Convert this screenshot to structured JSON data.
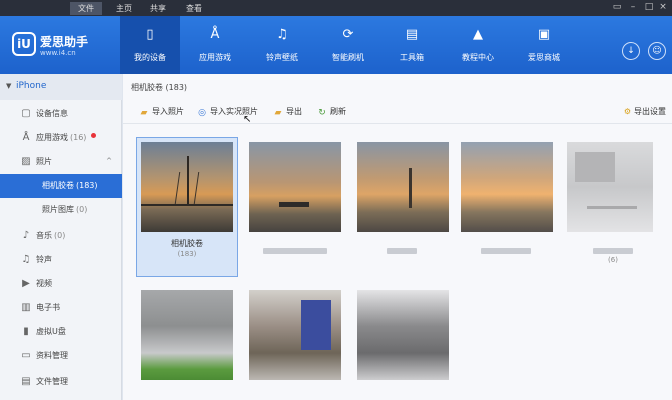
{
  "menubar": {
    "items": [
      "文件",
      "主页",
      "共享",
      "查看"
    ],
    "active_index": 0
  },
  "app": {
    "logo_text": "iU",
    "name": "爱思助手",
    "url": "www.i4.cn"
  },
  "nav": [
    {
      "label": "我的设备",
      "icon": "phone-icon",
      "active": true
    },
    {
      "label": "应用游戏",
      "icon": "app-store-icon",
      "active": false
    },
    {
      "label": "铃声壁纸",
      "icon": "music-file-icon",
      "active": false
    },
    {
      "label": "智能刷机",
      "icon": "refresh-icon",
      "active": false
    },
    {
      "label": "工具箱",
      "icon": "toolbox-icon",
      "active": false
    },
    {
      "label": "教程中心",
      "icon": "graduation-cap-icon",
      "active": false
    },
    {
      "label": "爱思商城",
      "icon": "store-icon",
      "active": false
    }
  ],
  "sidebar": {
    "device": "iPhone",
    "items": [
      {
        "label": "设备信息",
        "count": "",
        "icon": "info-icon"
      },
      {
        "label": "应用游戏",
        "count": "(16)",
        "icon": "apps-icon",
        "badge": true
      },
      {
        "label": "照片",
        "count": "",
        "icon": "photo-icon",
        "expanded": true
      },
      {
        "label": "相机胶卷",
        "count": "(183)",
        "sub": true,
        "selected": true
      },
      {
        "label": "照片图库",
        "count": "(0)",
        "sub": true
      },
      {
        "label": "音乐",
        "count": "(0)",
        "icon": "music-icon"
      },
      {
        "label": "铃声",
        "count": "",
        "icon": "bell-icon"
      },
      {
        "label": "视频",
        "count": "",
        "icon": "video-icon"
      },
      {
        "label": "电子书",
        "count": "",
        "icon": "book-icon"
      },
      {
        "label": "虚拟U盘",
        "count": "",
        "icon": "usb-icon"
      },
      {
        "label": "资料管理",
        "count": "",
        "icon": "folder-icon"
      },
      {
        "label": "文件管理",
        "count": "",
        "icon": "file-icon"
      }
    ]
  },
  "main": {
    "breadcrumb": "相机胶卷 (183)",
    "toolbar": {
      "import_photos": "导入照片",
      "import_live": "导入实况照片",
      "export": "导出",
      "refresh": "刷新",
      "export_settings": "导出设置"
    },
    "albums": [
      {
        "label": "相机胶卷",
        "count": "(183)",
        "selected": true
      },
      {
        "label": "",
        "count": ""
      },
      {
        "label": "",
        "count": ""
      },
      {
        "label": "",
        "count": ""
      },
      {
        "label": "",
        "count": "(6)"
      },
      {
        "label": "",
        "count": ""
      },
      {
        "label": "",
        "count": ""
      },
      {
        "label": "",
        "count": ""
      }
    ]
  }
}
